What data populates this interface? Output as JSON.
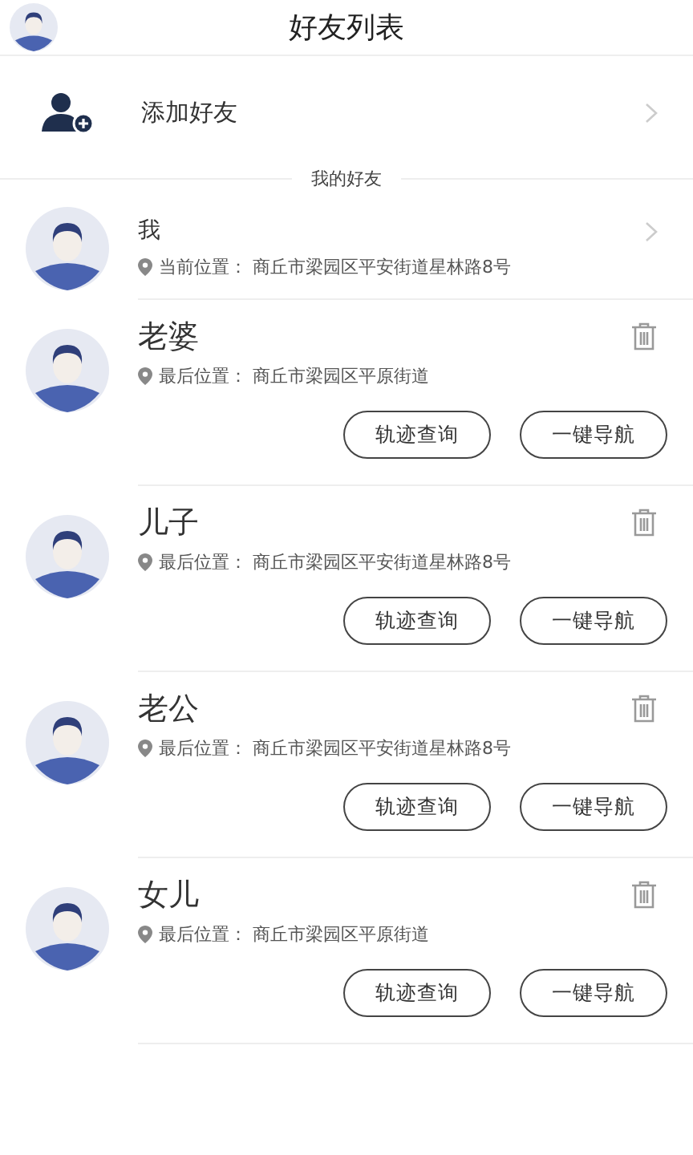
{
  "header": {
    "title": "好友列表"
  },
  "add_friend": {
    "label": "添加好友"
  },
  "section_title": "我的好友",
  "me": {
    "name": "我",
    "location": "当前位置： 商丘市梁园区平安街道星林路8号"
  },
  "friends": [
    {
      "name": "老婆",
      "location": "最后位置： 商丘市梁园区平原街道",
      "buttons": [
        "轨迹查询",
        "一键导航"
      ]
    },
    {
      "name": "儿子",
      "location": "最后位置： 商丘市梁园区平安街道星林路8号",
      "buttons": [
        "轨迹查询",
        "一键导航"
      ]
    },
    {
      "name": "老公",
      "location": "最后位置： 商丘市梁园区平安街道星林路8号",
      "buttons": [
        "轨迹查询",
        "一键导航"
      ]
    },
    {
      "name": "女儿",
      "location": "最后位置： 商丘市梁园区平原街道",
      "buttons": [
        "轨迹查询",
        "一键导航"
      ]
    }
  ]
}
